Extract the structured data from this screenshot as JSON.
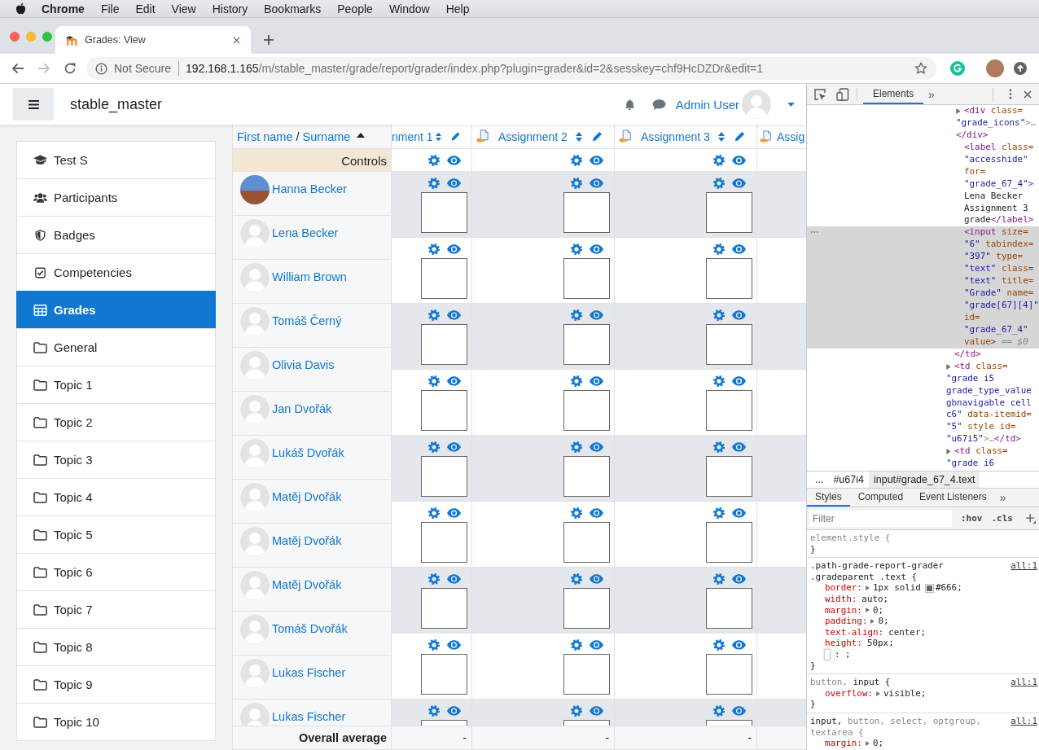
{
  "menubar": {
    "app": "Chrome",
    "items": [
      "File",
      "Edit",
      "View",
      "History",
      "Bookmarks",
      "People",
      "Window",
      "Help"
    ]
  },
  "browser": {
    "tabs": [
      {
        "title": "Grades: View",
        "selected": true
      }
    ],
    "security_label": "Not Secure",
    "url_host": "192.168.1.165",
    "url_path": "/m/stable_master/grade/report/grader/index.php?plugin=grader&id=2&sesskey=chf9HcDZDr&edit=1"
  },
  "navbar": {
    "site_name": "stable_master",
    "user_name": "Admin User"
  },
  "sidebar": {
    "items": [
      {
        "kind": "course",
        "label": "Test S",
        "selected": false
      },
      {
        "kind": "participants",
        "label": "Participants",
        "selected": false
      },
      {
        "kind": "badges",
        "label": "Badges",
        "selected": false
      },
      {
        "kind": "competencies",
        "label": "Competencies",
        "selected": false
      },
      {
        "kind": "grades",
        "label": "Grades",
        "selected": true
      },
      {
        "kind": "section",
        "label": "General",
        "selected": false
      },
      {
        "kind": "section",
        "label": "Topic 1",
        "selected": false
      },
      {
        "kind": "section",
        "label": "Topic 2",
        "selected": false
      },
      {
        "kind": "section",
        "label": "Topic 3",
        "selected": false
      },
      {
        "kind": "section",
        "label": "Topic 4",
        "selected": false
      },
      {
        "kind": "section",
        "label": "Topic 5",
        "selected": false
      },
      {
        "kind": "section",
        "label": "Topic 6",
        "selected": false
      },
      {
        "kind": "section",
        "label": "Topic 7",
        "selected": false
      },
      {
        "kind": "section",
        "label": "Topic 8",
        "selected": false
      },
      {
        "kind": "section",
        "label": "Topic 9",
        "selected": false
      },
      {
        "kind": "section",
        "label": "Topic 10",
        "selected": false
      }
    ]
  },
  "grader": {
    "name_header": {
      "first_name": "First name",
      "separator": "/",
      "surname": "Surname"
    },
    "controls_label": "Controls",
    "columns": [
      {
        "kind": "cut-left",
        "label": "nment 1",
        "average": "-"
      },
      {
        "kind": "full",
        "label": "Assignment 2",
        "average": "-"
      },
      {
        "kind": "full",
        "label": "Assignment 3",
        "average": "-"
      },
      {
        "kind": "cut-right",
        "label": "Assig"
      }
    ],
    "students": [
      {
        "name": "Hanna Becker",
        "has_photo": true
      },
      {
        "name": "Lena Becker",
        "has_photo": false
      },
      {
        "name": "William Brown",
        "has_photo": false
      },
      {
        "name": "Tomáš Černý",
        "has_photo": false
      },
      {
        "name": "Olivia Davis",
        "has_photo": false
      },
      {
        "name": "Jan Dvořák",
        "has_photo": false
      },
      {
        "name": "Lukáš Dvořák",
        "has_photo": false
      },
      {
        "name": "Matěj Dvořák",
        "has_photo": false
      },
      {
        "name": "Matěj Dvořák",
        "has_photo": false
      },
      {
        "name": "Matěj Dvořák",
        "has_photo": false
      },
      {
        "name": "Tomáš Dvořák",
        "has_photo": false
      },
      {
        "name": "Lukas Fischer",
        "has_photo": false
      },
      {
        "name": "Lukas Fischer",
        "has_photo": false
      }
    ],
    "grade_rows": [
      {
        "shaded": true
      },
      {
        "shaded": false
      },
      {
        "shaded": true
      },
      {
        "shaded": false
      },
      {
        "shaded": true
      },
      {
        "shaded": false
      },
      {
        "shaded": true
      },
      {
        "shaded": false
      },
      {
        "shaded": true
      }
    ],
    "overall_label": "Overall average"
  },
  "devtools": {
    "tabs": [
      {
        "label": "Elements",
        "selected": true
      }
    ],
    "more_tabs": "»",
    "dom_tree": [
      {
        "kind": "open",
        "selected": false,
        "closing": [
          {
            "kind": "tag",
            "text": "</td>"
          }
        ],
        "children": [
          {
            "kind": "collapsed",
            "selected": false,
            "lines": [
              [
                {
                  "kind": "tag",
                  "text": "<div"
                },
                {
                  "kind": "attr",
                  "text": " class="
                }
              ],
              [
                {
                  "kind": "value",
                  "text": "\"grade_icons\""
                },
                {
                  "kind": "punct",
                  "text": ">…"
                }
              ],
              [
                {
                  "kind": "tag",
                  "text": "</div>"
                }
              ]
            ]
          },
          {
            "kind": "leaf",
            "selected": false,
            "lines": [
              [
                {
                  "kind": "tag",
                  "text": "<label"
                },
                {
                  "kind": "attr",
                  "text": " class="
                }
              ],
              [
                {
                  "kind": "value",
                  "text": "\"accesshide\""
                }
              ],
              [
                {
                  "kind": "attr",
                  "text": "for="
                }
              ],
              [
                {
                  "kind": "value",
                  "text": "\"grade_67_4\""
                },
                {
                  "kind": "tag",
                  "text": ">"
                }
              ],
              [
                {
                  "kind": "text",
                  "text": "Lena Becker"
                }
              ],
              [
                {
                  "kind": "text",
                  "text": "Assignment 3"
                }
              ],
              [
                {
                  "kind": "text",
                  "text": "grade"
                },
                {
                  "kind": "tag",
                  "text": "</label>"
                }
              ]
            ]
          },
          {
            "kind": "leaf",
            "selected": true,
            "lines": [
              [
                {
                  "kind": "tag",
                  "text": "<input"
                },
                {
                  "kind": "attr",
                  "text": " size="
                }
              ],
              [
                {
                  "kind": "value",
                  "text": "\"6\""
                },
                {
                  "kind": "attr",
                  "text": " tabindex="
                }
              ],
              [
                {
                  "kind": "value",
                  "text": "\"397\""
                },
                {
                  "kind": "attr",
                  "text": " type="
                }
              ],
              [
                {
                  "kind": "value",
                  "text": "\"text\""
                },
                {
                  "kind": "attr",
                  "text": " class="
                }
              ],
              [
                {
                  "kind": "value",
                  "text": "\"text\""
                },
                {
                  "kind": "attr",
                  "text": " title="
                }
              ],
              [
                {
                  "kind": "value",
                  "text": "\"Grade\""
                },
                {
                  "kind": "attr",
                  "text": " name="
                }
              ],
              [
                {
                  "kind": "value",
                  "text": "\"grade[67][4]\""
                }
              ],
              [
                {
                  "kind": "attr",
                  "text": "id="
                }
              ],
              [
                {
                  "kind": "value",
                  "text": "\"grade_67_4\""
                }
              ],
              [
                {
                  "kind": "attr",
                  "text": "value"
                },
                {
                  "kind": "tag",
                  "text": ">"
                },
                {
                  "kind": "punct",
                  "text": " =="
                },
                {
                  "kind": "hint",
                  "text": " $0"
                }
              ]
            ]
          }
        ]
      },
      {
        "kind": "collapsed",
        "selected": false,
        "lines": [
          [
            {
              "kind": "tag",
              "text": "<td"
            },
            {
              "kind": "attr",
              "text": " class="
            }
          ],
          [
            {
              "kind": "value",
              "text": "\"grade i5"
            }
          ],
          [
            {
              "kind": "value",
              "text": "grade_type_value"
            }
          ],
          [
            {
              "kind": "value",
              "text": "gbnavigable cell"
            }
          ],
          [
            {
              "kind": "value",
              "text": "c6\""
            },
            {
              "kind": "attr",
              "text": " data-itemid="
            }
          ],
          [
            {
              "kind": "value",
              "text": "\"5\""
            },
            {
              "kind": "attr",
              "text": " style id="
            }
          ],
          [
            {
              "kind": "value",
              "text": "\"u67i5\""
            },
            {
              "kind": "punct",
              "text": ">…"
            },
            {
              "kind": "tag",
              "text": "</td>"
            }
          ]
        ]
      },
      {
        "kind": "collapsed",
        "selected": false,
        "lines": [
          [
            {
              "kind": "tag",
              "text": "<td"
            },
            {
              "kind": "attr",
              "text": " class="
            }
          ],
          [
            {
              "kind": "value",
              "text": "\"grade i6"
            }
          ]
        ]
      }
    ],
    "breadcrumbs": [
      {
        "label": "...",
        "selected": false
      },
      {
        "label": "#u67i4",
        "selected": false
      },
      {
        "label": "input#grade_67_4.text",
        "selected": true
      }
    ],
    "panel_tabs": [
      {
        "label": "Styles",
        "selected": true
      },
      {
        "label": "Computed",
        "selected": false
      },
      {
        "label": "Event Listeners",
        "selected": false
      }
    ],
    "panel_more": "»",
    "filter": {
      "placeholder": "Filter"
    },
    "filter_buttons": [
      ":hov",
      ".cls"
    ],
    "rules": [
      {
        "selector": [
          {
            "text": "element.style {",
            "matched": false
          }
        ],
        "close": "}"
      },
      {
        "selector": [
          {
            "text": ".path-grade-report-grader .gradeparent .text {",
            "matched": true
          }
        ],
        "source": "all:1",
        "declarations": [
          {
            "kind": "property",
            "property": "border:",
            "expandable": true,
            "value": "1px solid",
            "color": "#666666",
            "color_text": "#666;"
          },
          {
            "kind": "property",
            "property": "width:",
            "expandable": false,
            "value": "auto;"
          },
          {
            "kind": "property",
            "property": "margin:",
            "expandable": true,
            "value": "0;"
          },
          {
            "kind": "property",
            "property": "padding:",
            "expandable": true,
            "value": "0;"
          },
          {
            "kind": "property",
            "property": "text-align:",
            "expandable": false,
            "value": "center;"
          },
          {
            "kind": "property",
            "property": "height:",
            "expandable": false,
            "value": "50px;"
          },
          {
            "kind": "new",
            "text": ": ;"
          }
        ],
        "close": "}"
      },
      {
        "selector": [
          {
            "text": "button,",
            "matched": false
          },
          {
            "text": "input {",
            "matched": true
          }
        ],
        "source": "all:1",
        "declarations": [
          {
            "kind": "property",
            "property": "overflow:",
            "expandable": true,
            "value": "visible;"
          }
        ],
        "close": "}"
      },
      {
        "selector": [
          {
            "text": "input,",
            "matched": true
          },
          {
            "text": "button, select, optgroup, textarea {",
            "matched": false
          }
        ],
        "source": "all:1",
        "declarations": [
          {
            "kind": "property",
            "property": "margin:",
            "expandable": true,
            "value": "0;"
          }
        ]
      }
    ]
  }
}
